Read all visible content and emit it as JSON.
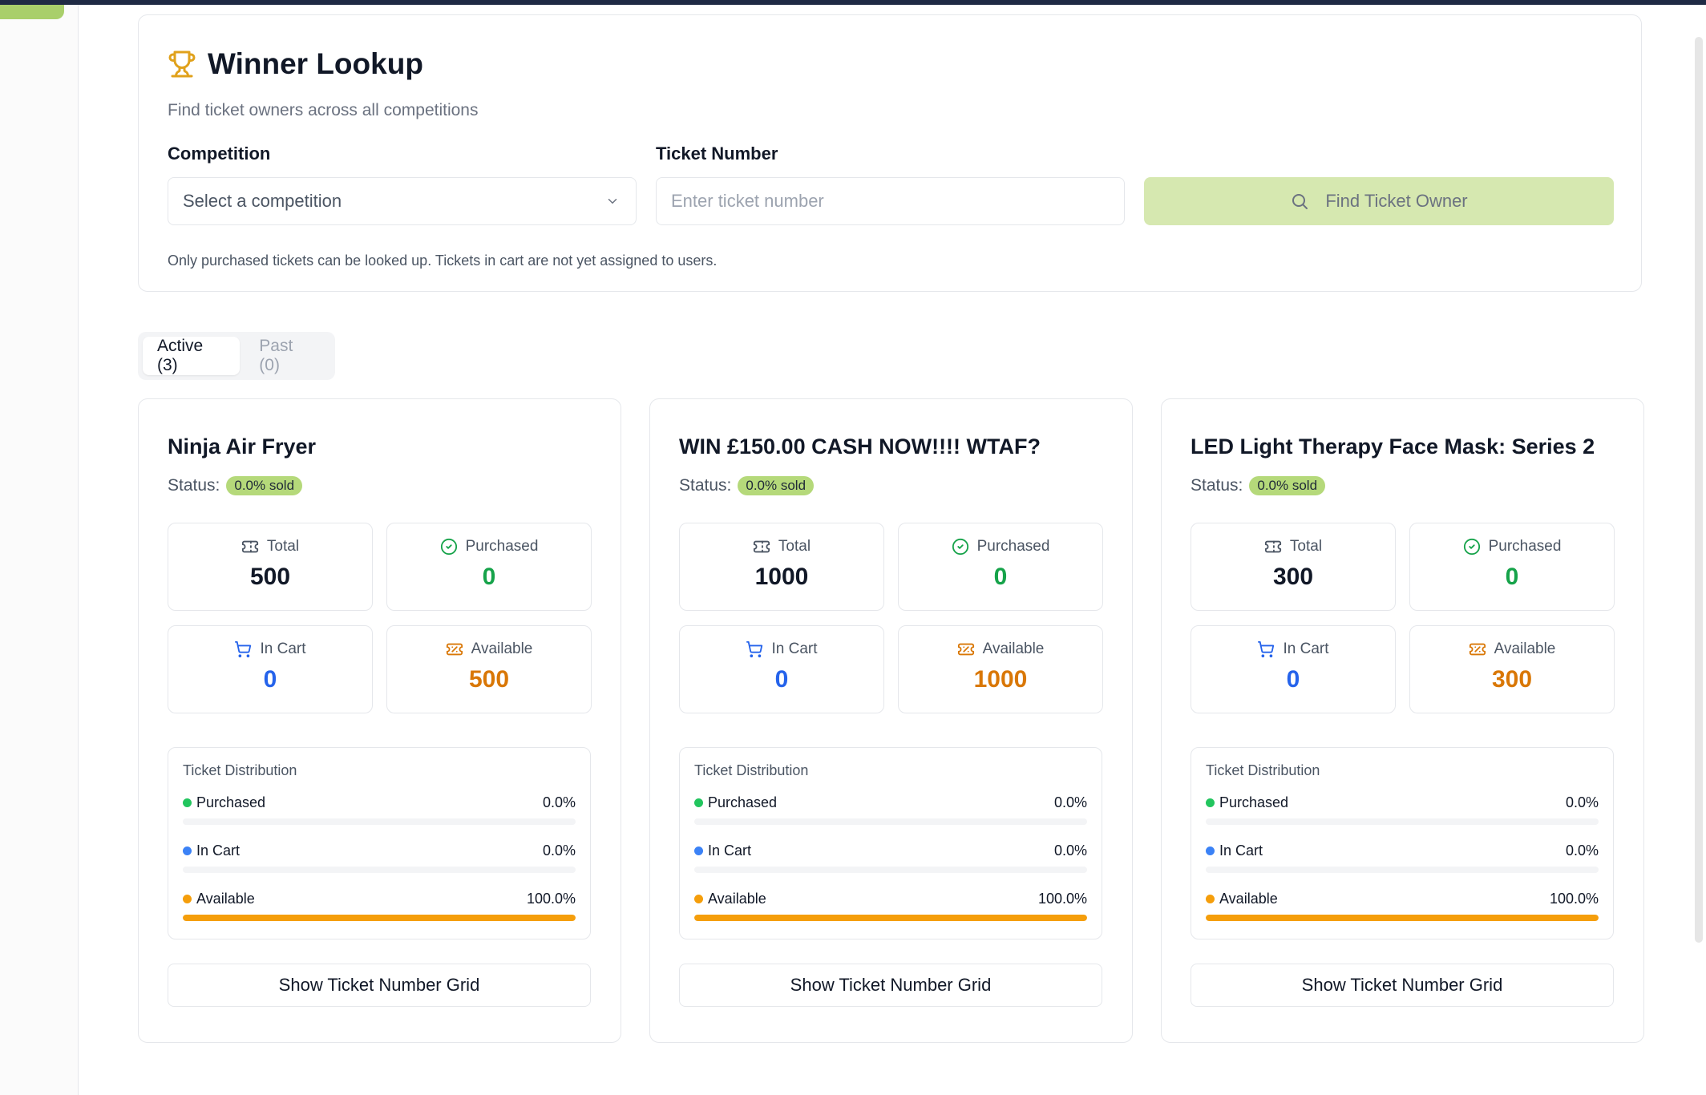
{
  "lookup": {
    "title": "Winner Lookup",
    "subtitle": "Find ticket owners across all competitions",
    "competition_label": "Competition",
    "competition_placeholder": "Select a competition",
    "ticket_label": "Ticket Number",
    "ticket_placeholder": "Enter ticket number",
    "find_button": "Find Ticket Owner",
    "note": "Only purchased tickets can be looked up. Tickets in cart are not yet assigned to users."
  },
  "tabs": [
    {
      "label": "Active (3)",
      "active": true
    },
    {
      "label": "Past (0)",
      "active": false
    }
  ],
  "card_labels": {
    "status": "Status:",
    "total": "Total",
    "purchased": "Purchased",
    "in_cart": "In Cart",
    "available": "Available",
    "distribution_title": "Ticket Distribution",
    "grid_button": "Show Ticket Number Grid"
  },
  "colors": {
    "accent": "#a9cf6b",
    "purchased": "#16a34a",
    "in_cart": "#2563eb",
    "available": "#d97706",
    "available_bar": "#f59e0b",
    "purchased_dot": "#22c55e",
    "in_cart_dot": "#3b82f6"
  },
  "competitions": [
    {
      "name": "Ninja Air Fryer",
      "status_badge": "0.0% sold",
      "total": "500",
      "purchased": "0",
      "in_cart": "0",
      "available": "500",
      "purchased_pct": "0.0%",
      "in_cart_pct": "0.0%",
      "available_pct": "100.0%",
      "purchased_fraction": 0,
      "in_cart_fraction": 0,
      "available_fraction": 1
    },
    {
      "name": "WIN £150.00 CASH NOW!!!! WTAF?",
      "status_badge": "0.0% sold",
      "total": "1000",
      "purchased": "0",
      "in_cart": "0",
      "available": "1000",
      "purchased_pct": "0.0%",
      "in_cart_pct": "0.0%",
      "available_pct": "100.0%",
      "purchased_fraction": 0,
      "in_cart_fraction": 0,
      "available_fraction": 1
    },
    {
      "name": "LED Light Therapy Face Mask: Series 2",
      "status_badge": "0.0% sold",
      "total": "300",
      "purchased": "0",
      "in_cart": "0",
      "available": "300",
      "purchased_pct": "0.0%",
      "in_cart_pct": "0.0%",
      "available_pct": "100.0%",
      "purchased_fraction": 0,
      "in_cart_fraction": 0,
      "available_fraction": 1
    }
  ]
}
